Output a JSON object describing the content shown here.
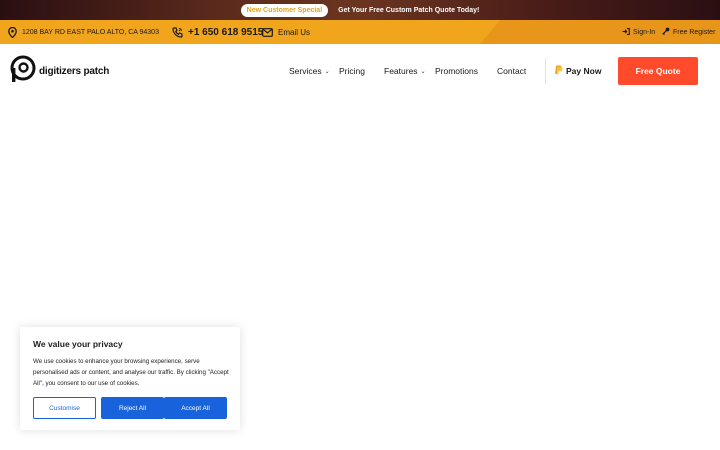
{
  "promo": {
    "badge": "New Customer Special",
    "text": "Get Your Free Custom Patch Quote Today!"
  },
  "infobar": {
    "address": "1208 BAY RD EAST PALO ALTO, CA 94303",
    "phone": "+1 650 618 9515",
    "email": "Email Us",
    "signin": "Sign-In",
    "register": "Free Register",
    "icons": [
      "map-pin-icon",
      "phone-icon",
      "envelope-icon",
      "sign-in-icon",
      "key-icon"
    ],
    "colors": {
      "bar": "#f0a51c"
    }
  },
  "nav": {
    "logo_text": "digitizers patch",
    "items": [
      {
        "label": "Services",
        "has_dropdown": true
      },
      {
        "label": "Pricing",
        "has_dropdown": false
      },
      {
        "label": "Features",
        "has_dropdown": true
      },
      {
        "label": "Promotions",
        "has_dropdown": false
      },
      {
        "label": "Contact",
        "has_dropdown": false
      }
    ],
    "pay_now": "Pay Now",
    "quote_button": "Free Quote",
    "colors": {
      "accent": "#ff4a2b"
    }
  },
  "cookie": {
    "title": "We value your privacy",
    "description": "We use cookies to enhance your browsing experience, serve personalised ads or content, and analyse our traffic. By clicking \"Accept All\", you consent to our use of cookies.",
    "buttons": {
      "customise": "Customise",
      "reject": "Reject All",
      "accept": "Accept All"
    },
    "colors": {
      "primary": "#1863dc"
    }
  }
}
